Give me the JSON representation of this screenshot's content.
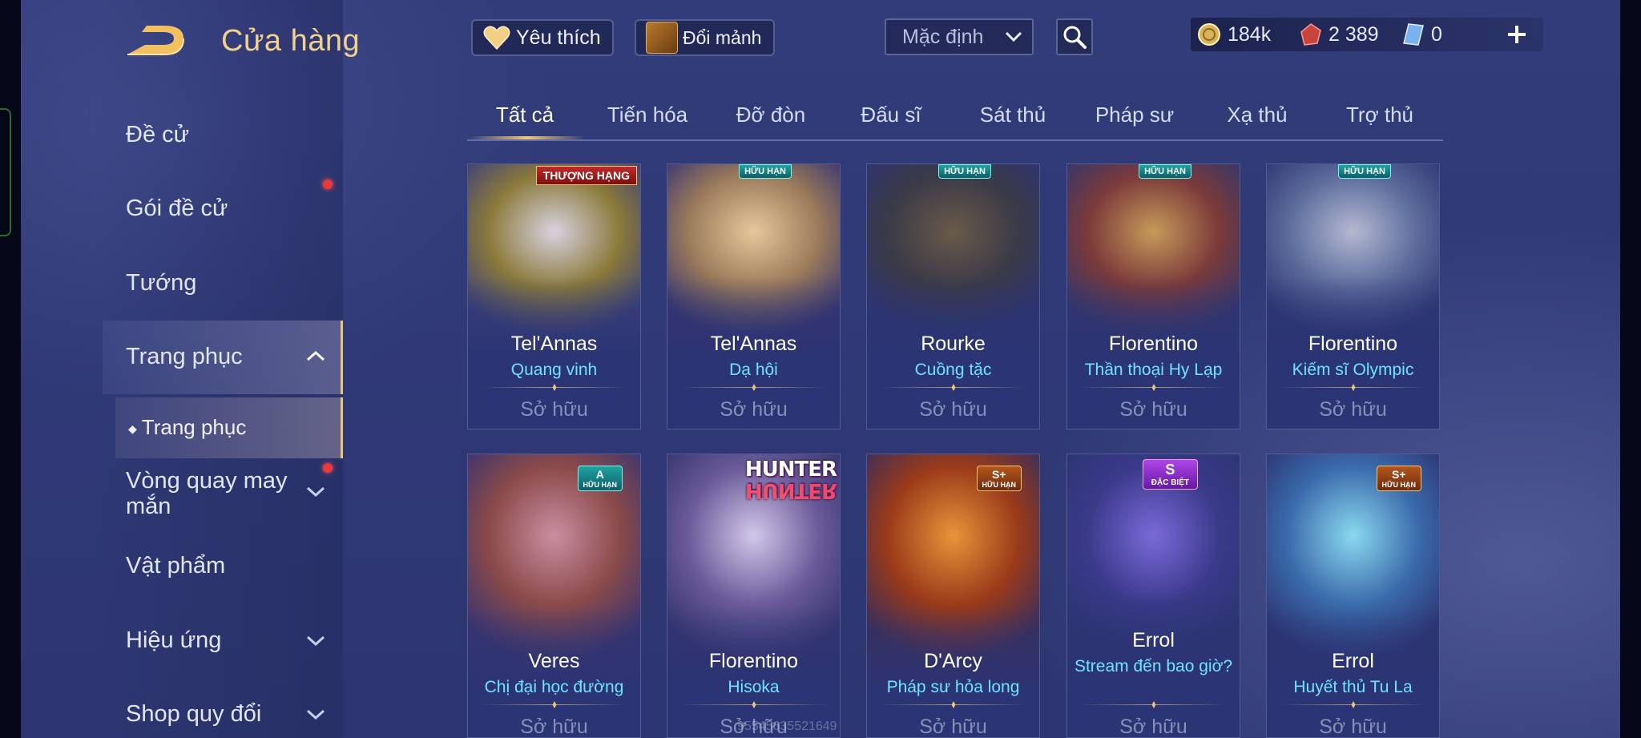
{
  "header": {
    "title": "Cửa hàng",
    "favorites_label": "Yêu thích",
    "shards_label": "Đổi mảnh",
    "sort_selected": "Mặc định"
  },
  "currency": {
    "gold": "184k",
    "gems": "2 389",
    "vouchers": "0"
  },
  "sidebar": {
    "items": [
      {
        "label": "Đề cử"
      },
      {
        "label": "Gói đề cử"
      },
      {
        "label": "Tướng"
      },
      {
        "label": "Trang phục"
      },
      {
        "label": "Vòng quay may mắn"
      },
      {
        "label": "Vật phẩm"
      },
      {
        "label": "Hiệu ứng"
      },
      {
        "label": "Shop quy đổi"
      }
    ],
    "sub_item": "Trang phục"
  },
  "tabs": [
    {
      "label": "Tất cả"
    },
    {
      "label": "Tiến hóa"
    },
    {
      "label": "Đỡ đòn"
    },
    {
      "label": "Đấu sĩ"
    },
    {
      "label": "Sát thủ"
    },
    {
      "label": "Pháp sư"
    },
    {
      "label": "Xạ thủ"
    },
    {
      "label": "Trợ thủ"
    }
  ],
  "cards": [
    {
      "hero": "Tel'Annas",
      "skin": "Quang vinh",
      "status": "Sở hữu",
      "badge": "THƯỢNG HẠNG",
      "colors": [
        "#d8d2e0",
        "#8a7a3a",
        "#3b3f7a"
      ]
    },
    {
      "hero": "Tel'Annas",
      "skin": "Dạ hội",
      "status": "Sở hữu",
      "badge": "HỮU HẠN",
      "colors": [
        "#e6c79a",
        "#9a7a5a",
        "#3a3570"
      ]
    },
    {
      "hero": "Rourke",
      "skin": "Cuồng tặc",
      "status": "Sở hữu",
      "badge": "HỮU HẠN",
      "colors": [
        "#6a5a4a",
        "#3a3a48",
        "#2e3470"
      ]
    },
    {
      "hero": "Florentino",
      "skin": "Thần thoại Hy Lạp",
      "status": "Sở hữu",
      "badge": "HỮU HẠN",
      "colors": [
        "#c69a5a",
        "#7a3a3a",
        "#33366e"
      ]
    },
    {
      "hero": "Florentino",
      "skin": "Kiếm sĩ Olympic",
      "status": "Sở hữu",
      "badge": "HỮU HẠN",
      "colors": [
        "#b4b8d2",
        "#5a6a9a",
        "#2f3672"
      ]
    },
    {
      "hero": "Veres",
      "skin": "Chị đại học đường",
      "status": "Sở hữu",
      "badge": "A",
      "badge_sub": "HỮU HẠN",
      "colors": [
        "#c98ea0",
        "#8a4a4a",
        "#3a3470"
      ]
    },
    {
      "hero": "Florentino",
      "skin": "Hisoka",
      "status": "Sở hữu",
      "logo_top": "HUNTER",
      "logo_bottom": "HUNTER",
      "colors": [
        "#d0c8e8",
        "#6a5a9a",
        "#34346e"
      ]
    },
    {
      "hero": "D'Arcy",
      "skin": "Pháp sư hỏa long",
      "status": "Sở hữu",
      "badge": "S+",
      "badge_sub": "HỮU HẠN",
      "colors": [
        "#e8943a",
        "#9a3a1a",
        "#3a2e5a"
      ]
    },
    {
      "hero": "Errol",
      "skin": "Stream đến bao giờ?",
      "status": "Sở hữu",
      "badge": "S",
      "badge_sub": "ĐẶC BIỆT",
      "colors": [
        "#7a6ad8",
        "#3a3a8a",
        "#2d3470"
      ]
    },
    {
      "hero": "Errol",
      "skin": "Huyết thủ Tu La",
      "status": "Sở hữu",
      "badge": "S+",
      "badge_sub": "HỮU HẠN",
      "colors": [
        "#8ad8f0",
        "#3a6aaa",
        "#2d3472"
      ]
    }
  ],
  "watermark": "95545635521649",
  "colors": {
    "accent_gold": "#f2d28a",
    "skin_name": "#6fe3ff",
    "status_owned": "#8890b8",
    "notification": "#e83a3a"
  }
}
